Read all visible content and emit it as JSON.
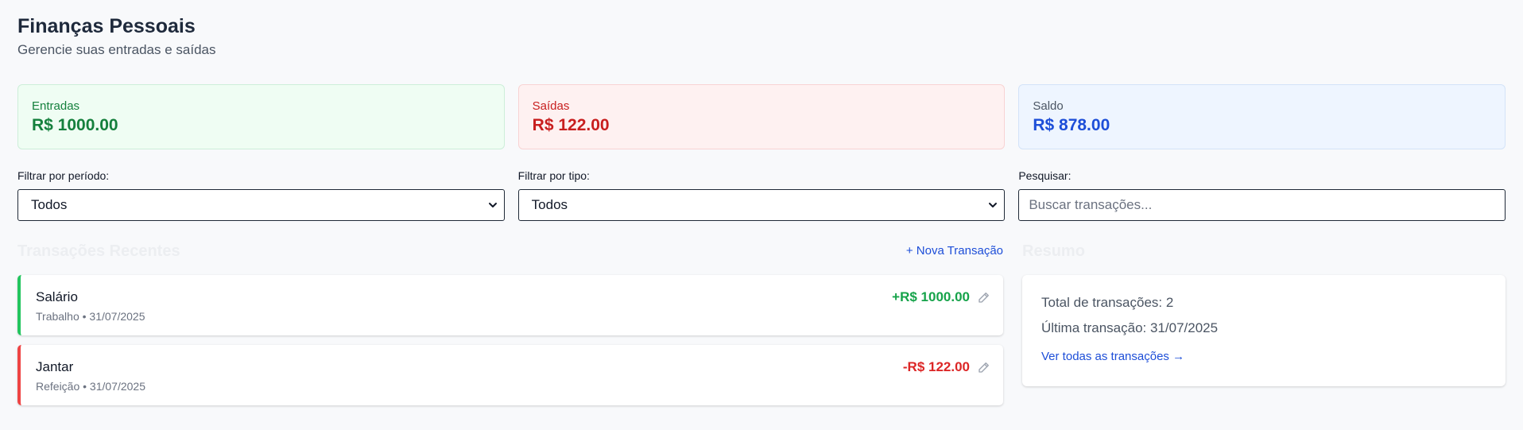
{
  "header": {
    "title": "Finanças Pessoais",
    "subtitle": "Gerencie suas entradas e saídas"
  },
  "cards": {
    "income": {
      "label": "Entradas",
      "value": "R$ 1000.00"
    },
    "expenses": {
      "label": "Saídas",
      "value": "R$ 122.00"
    },
    "balance": {
      "label": "Saldo",
      "value": "R$ 878.00"
    }
  },
  "filters": {
    "period": {
      "label": "Filtrar por período:",
      "selected": "Todos"
    },
    "type": {
      "label": "Filtrar por tipo:",
      "selected": "Todos"
    },
    "search": {
      "label": "Pesquisar:",
      "placeholder": "Buscar transações..."
    }
  },
  "transactions": {
    "title": "Transações Recentes",
    "new_label": "+ Nova Transação",
    "items": [
      {
        "name": "Salário",
        "meta": "Trabalho • 31/07/2025",
        "amount": "+R$ 1000.00",
        "kind": "income"
      },
      {
        "name": "Jantar",
        "meta": "Refeição • 31/07/2025",
        "amount": "-R$ 122.00",
        "kind": "expense"
      }
    ]
  },
  "summary": {
    "title": "Resumo",
    "total": "Total de transações: 2",
    "last": "Última transação: 31/07/2025",
    "link": "Ver todas as transações →"
  },
  "icons": {
    "edit": "pencil-icon",
    "select_arrow": "chevron-down-icon"
  },
  "colors": {
    "income": "#16a34a",
    "expense": "#dc2626",
    "balance": "#1d4ed8",
    "link": "#1d4ed8"
  }
}
